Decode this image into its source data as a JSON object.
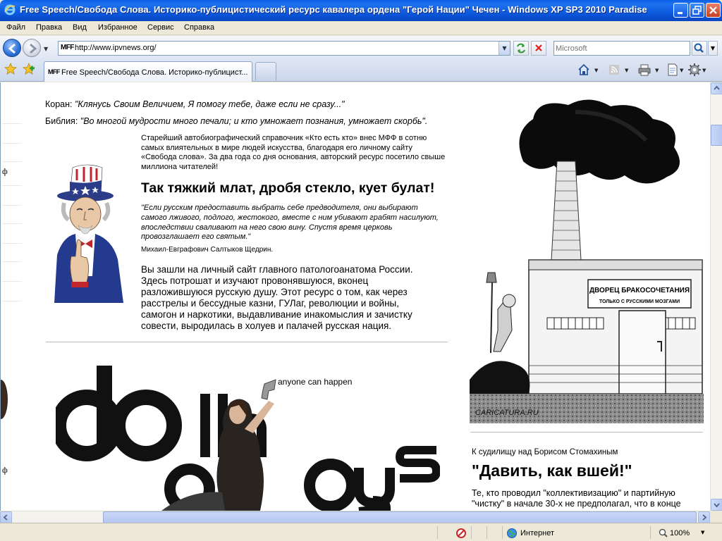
{
  "window": {
    "title": "Free Speech/Свобода Слова. Историко-публицистический ресурс кавалера ордена \"Герой Нации\" Чечен - Windows XP SP3 2010 Paradise"
  },
  "menu": {
    "items": [
      "Файл",
      "Правка",
      "Вид",
      "Избранное",
      "Сервис",
      "Справка"
    ]
  },
  "address_bar": {
    "site_icon_text": "MFF",
    "url": "http://www.ipvnews.org/"
  },
  "search": {
    "placeholder": "Microsoft"
  },
  "tabs": [
    {
      "icon_text": "MFF",
      "label": "Free Speech/Свобода Слова. Историко-публицист..."
    }
  ],
  "content": {
    "left_strip_glyphs": [
      "ф",
      "ф"
    ],
    "koran_label": "Коран: ",
    "koran_quote": "\"Клянусь Своим Величием, Я помогу тебе, даже если не сразу...\"",
    "bible_label": "Библия: ",
    "bible_quote": "\"Во многой мудрости много печали; и кто умножает познания, умножает скорбь\".",
    "intro": "Старейший автобиографический справочник «Кто есть кто» внес МФФ в сотню самых влиятельных в мире людей искусства, благодаря его личному сайту «Свобода слова». За два года со дня основания, авторский ресурс посетило свыше миллиона читателей!",
    "headline": "Так тяжкий млат, дробя стекло, кует булат!",
    "italic_quote": "\"Если русским предоставить выбрать себе предводителя, они выбирают самого лживого, подлого, жестокого, вместе с ним убивают грабят насилуют, впоследствии сваливают на него свою вину. Спустя время церковь провозглашает его святым.\"",
    "quote_author": "Михаил-Евграфович Салтыков Щедрин.",
    "main_text": "Вы зашли на личный сайт главного патологоанатома России. Здесь потрошат и изучают провонявшуюся, вконец разложившуюся русскую душу. Этот ресурс о том, как через расстрелы и бессудные казни, ГУЛаг, революции и войны, самогон и наркотики, выдавливание инакомыслия и зачистку совести, выродилась в холуев и палачей русская нация.",
    "banner": {
      "tagline": "anyone can happen",
      "big_letters": "dollhouse"
    },
    "cartoon": {
      "sign_title": "ДВОРЕЦ БРАКОСОЧЕТАНИЯ",
      "sign_subtitle": "ТОЛЬКО С РУССКИМИ МОЗГАМИ",
      "credit": "CARICATURA.RU"
    },
    "right_label": "К судилищу над Борисом Стомахиным",
    "right_headline": "\"Давить, как вшей!\"",
    "right_text": "Те, кто проводил \"коллективизацию\" и партийную \"чистку\" в начале 30-х не предполагал, что в конце"
  },
  "status": {
    "zone": "Интернет",
    "zoom": "100%"
  },
  "colors": {
    "titlebar": "#0b54d8",
    "chrome": "#ece9d8",
    "scroll": "#c9d7f7"
  }
}
